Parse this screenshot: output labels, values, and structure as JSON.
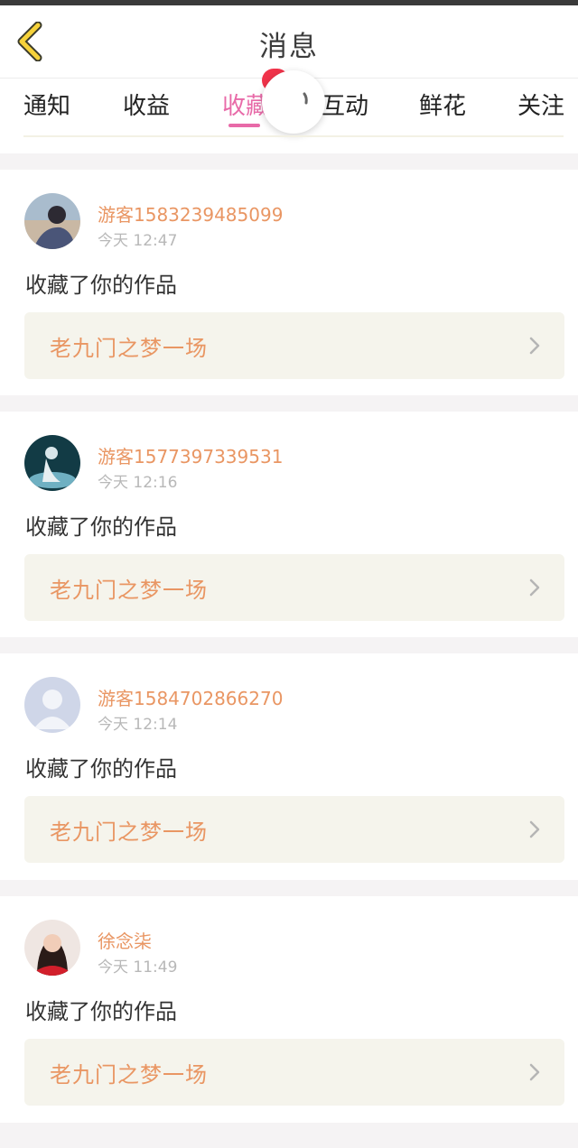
{
  "header": {
    "title": "消息"
  },
  "tabs": [
    {
      "label": "通知",
      "active": false
    },
    {
      "label": "收益",
      "active": false
    },
    {
      "label": "收藏",
      "active": true
    },
    {
      "label": "互动",
      "active": false
    },
    {
      "label": "鲜花",
      "active": false
    },
    {
      "label": "关注",
      "active": false
    }
  ],
  "colors": {
    "accent_pink": "#e86aa8",
    "name_orange": "#e99663",
    "badge_red": "#f0334a",
    "back_yellow": "#f6d23a"
  },
  "messages": [
    {
      "user": "游客1583239485099",
      "time": "今天 12:47",
      "action": "收藏了你的作品",
      "work": "老九门之梦一场"
    },
    {
      "user": "游客1577397339531",
      "time": "今天 12:16",
      "action": "收藏了你的作品",
      "work": "老九门之梦一场"
    },
    {
      "user": "游客1584702866270",
      "time": "今天 12:14",
      "action": "收藏了你的作品",
      "work": "老九门之梦一场"
    },
    {
      "user": "徐念柒",
      "time": "今天 11:49",
      "action": "收藏了你的作品",
      "work": "老九门之梦一场"
    }
  ]
}
